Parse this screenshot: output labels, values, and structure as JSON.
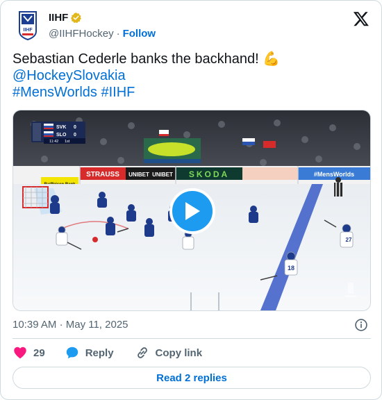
{
  "author": {
    "name": "IIHF",
    "handle": "@IIHFHockey",
    "separator": "·",
    "follow_label": "Follow",
    "verified_color": "#e2b719"
  },
  "tweet": {
    "text_line1": "Sebastian Cederle banks the backhand!",
    "emoji": "💪",
    "mention": "@HockeySlovakia",
    "hashtag1": "#MensWorlds",
    "hashtag2": "#IIHF"
  },
  "video": {
    "scorebug": {
      "team1": "SVK",
      "score1": "0",
      "team2": "SLO",
      "score2": "0",
      "clock": "11:42",
      "period": "1st"
    },
    "boards": [
      "STRAUSS",
      "UNIBET",
      "UNIBET",
      "SKODA",
      "Raiffeisen Bank",
      "#MensWorlds"
    ],
    "player_numbers": [
      "18",
      "27"
    ]
  },
  "meta": {
    "time": "10:39 AM",
    "separator": "·",
    "date": "May 11, 2025"
  },
  "actions": {
    "like_count": "29",
    "reply_label": "Reply",
    "copy_label": "Copy link"
  },
  "read_replies_label": "Read 2 replies",
  "colors": {
    "accent": "#1d9bf0",
    "link": "#006fd6",
    "like": "#f91880",
    "muted": "#536471"
  }
}
